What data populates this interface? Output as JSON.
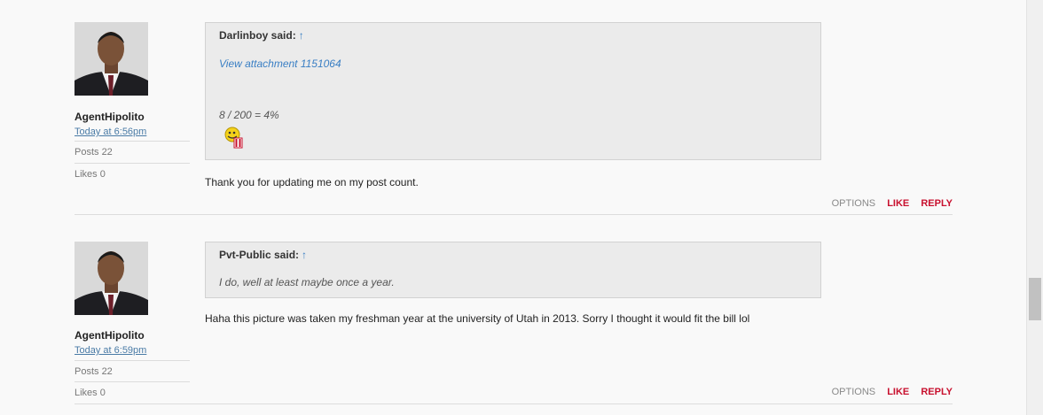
{
  "posts": [
    {
      "username": "AgentHipolito",
      "timestamp": "Today at 6:56pm",
      "posts_stat": "Posts 22",
      "likes_stat": "Likes 0",
      "quote_author": "Darlinboy said:",
      "quote_arrow": "↑",
      "quote_link": "View attachment 1151064",
      "quote_text": "8 / 200 = 4%",
      "message": "Thank you for updating me on my post count.",
      "actions": {
        "options": "OPTIONS",
        "like": "LIKE",
        "reply": "REPLY"
      }
    },
    {
      "username": "AgentHipolito",
      "timestamp": "Today at 6:59pm",
      "posts_stat": "Posts 22",
      "likes_stat": "Likes 0",
      "quote_author": "Pvt-Public said:",
      "quote_arrow": "↑",
      "quote_text": "I do, well at least maybe once a year.",
      "message": "Haha this picture was taken my freshman year at the university of Utah in 2013. Sorry I thought it would fit the bill lol",
      "actions": {
        "options": "OPTIONS",
        "like": "LIKE",
        "reply": "REPLY"
      }
    }
  ],
  "colors": {
    "accent_red": "#c8102e",
    "link_blue": "#3a7fc4"
  }
}
